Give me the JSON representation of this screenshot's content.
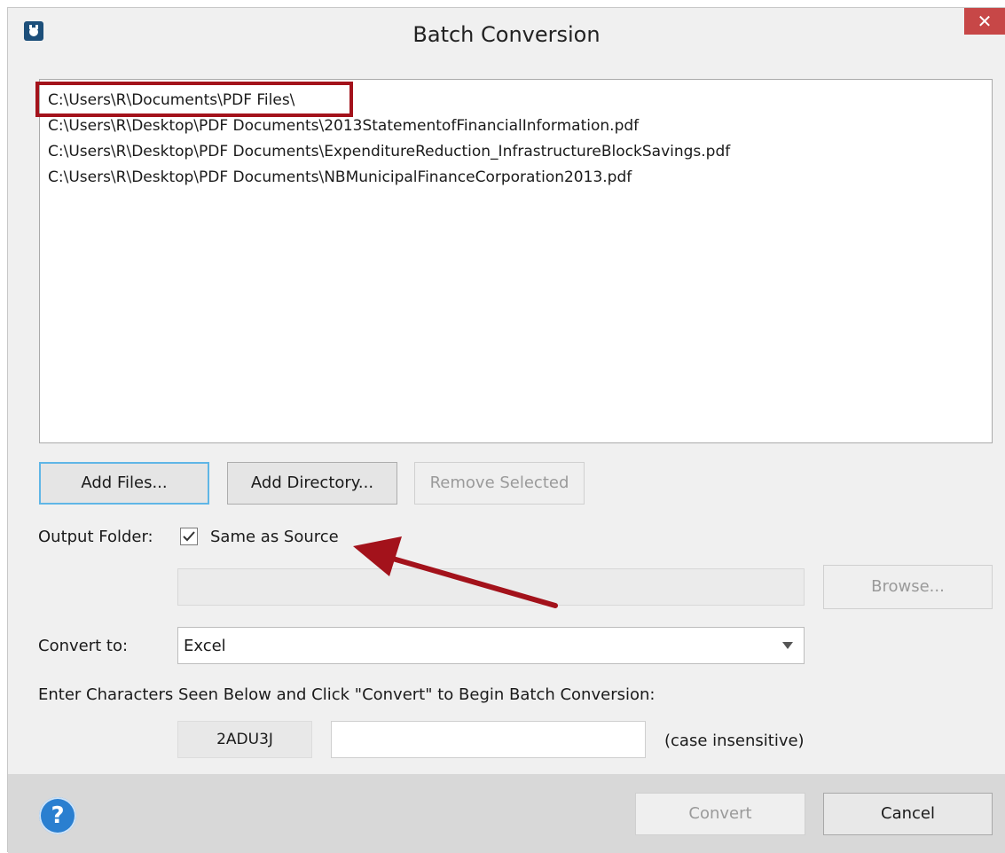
{
  "window": {
    "title": "Batch Conversion",
    "close_symbol": "✕",
    "app_icon": "app-icon"
  },
  "file_list": {
    "items": [
      "C:\\Users\\R\\Documents\\PDF Files\\",
      "C:\\Users\\R\\Desktop\\PDF Documents\\2013StatementofFinancialInformation.pdf",
      "C:\\Users\\R\\Desktop\\PDF Documents\\ExpenditureReduction_InfrastructureBlockSavings.pdf",
      "C:\\Users\\R\\Desktop\\PDF Documents\\NBMunicipalFinanceCorporation2013.pdf"
    ],
    "highlight_color": "#a3121b"
  },
  "buttons": {
    "add_files": "Add Files...",
    "add_directory": "Add Directory...",
    "remove_selected": "Remove Selected",
    "browse": "Browse...",
    "convert": "Convert",
    "cancel": "Cancel"
  },
  "output": {
    "label": "Output Folder:",
    "same_as_source_label": "Same as Source",
    "same_as_source_checked": true,
    "path_value": ""
  },
  "convert_to": {
    "label": "Convert to:",
    "selected": "Excel"
  },
  "captcha": {
    "instruction": "Enter Characters Seen Below and Click \"Convert\" to Begin Batch Conversion:",
    "code": "2ADU3J",
    "input_value": "",
    "hint": "(case insensitive)"
  },
  "footer": {
    "help_symbol": "?"
  },
  "annotation": {
    "arrow_color": "#a3121b"
  }
}
